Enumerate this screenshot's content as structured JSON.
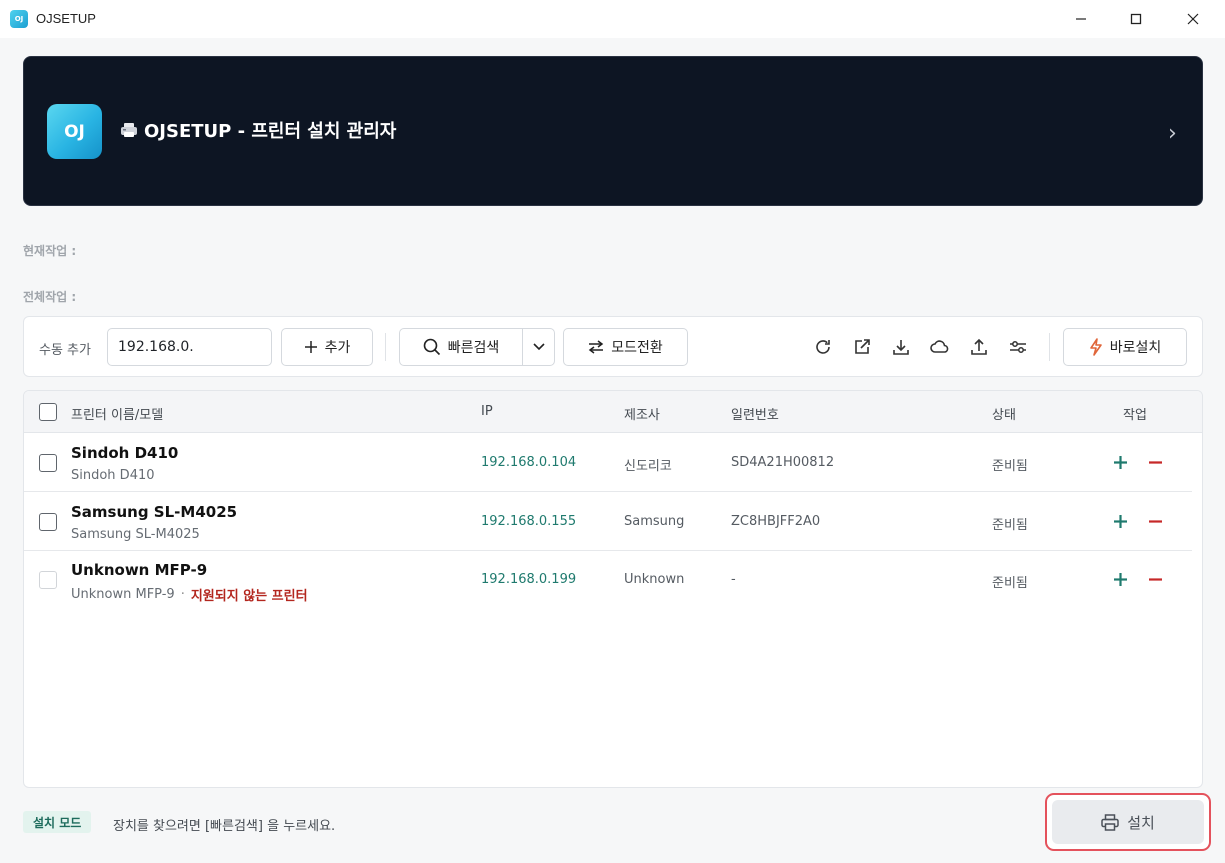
{
  "window": {
    "title": "OJSETUP",
    "logo_text": "OJ"
  },
  "banner": {
    "logo_text": "OJ",
    "title": "OJSETUP - 프린터 설치 관리자"
  },
  "progress": {
    "current_label": "현재작업 :",
    "total_label": "전체작업 :"
  },
  "toolbar": {
    "manual_add_label": "수동 추가",
    "ip_input_value": "192.168.0.",
    "add_label": "추가",
    "quick_search_label": "빠른검색",
    "mode_switch_label": "모드전환",
    "quick_install_label": "바로설치",
    "icons": [
      "refresh-icon",
      "external-link-icon",
      "download-icon",
      "cloud-icon",
      "upload-icon",
      "sliders-icon"
    ]
  },
  "table": {
    "columns": {
      "name": "프린터 이름/모델",
      "ip": "IP",
      "maker": "제조사",
      "serial": "일련번호",
      "status": "상태",
      "action": "작업"
    },
    "rows": [
      {
        "name": "Sindoh D410",
        "model": "Sindoh D410",
        "warning": "",
        "ip": "192.168.0.104",
        "maker": "신도리코",
        "serial": "SD4A21H00812",
        "status": "준비됨"
      },
      {
        "name": "Samsung SL-M4025",
        "model": "Samsung SL-M4025",
        "warning": "",
        "ip": "192.168.0.155",
        "maker": "Samsung",
        "serial": "ZC8HBJFF2A0",
        "status": "준비됨"
      },
      {
        "name": "Unknown MFP-9",
        "model": "Unknown MFP-9",
        "warning": "지원되지 않는 프린터",
        "ip": "192.168.0.199",
        "maker": "Unknown",
        "serial": "-",
        "status": "준비됨"
      }
    ]
  },
  "footer": {
    "mode_badge": "설치 모드",
    "hint": "장치를 찾으려면 [빠른검색] 을 누르세요.",
    "install_label": "설치"
  },
  "colors": {
    "banner_bg": "#0d1523",
    "accent_green": "#1f7a6e",
    "danger_red": "#c62828",
    "quick_install_icon": "#e0663a",
    "install_ring": "#e4525c"
  }
}
